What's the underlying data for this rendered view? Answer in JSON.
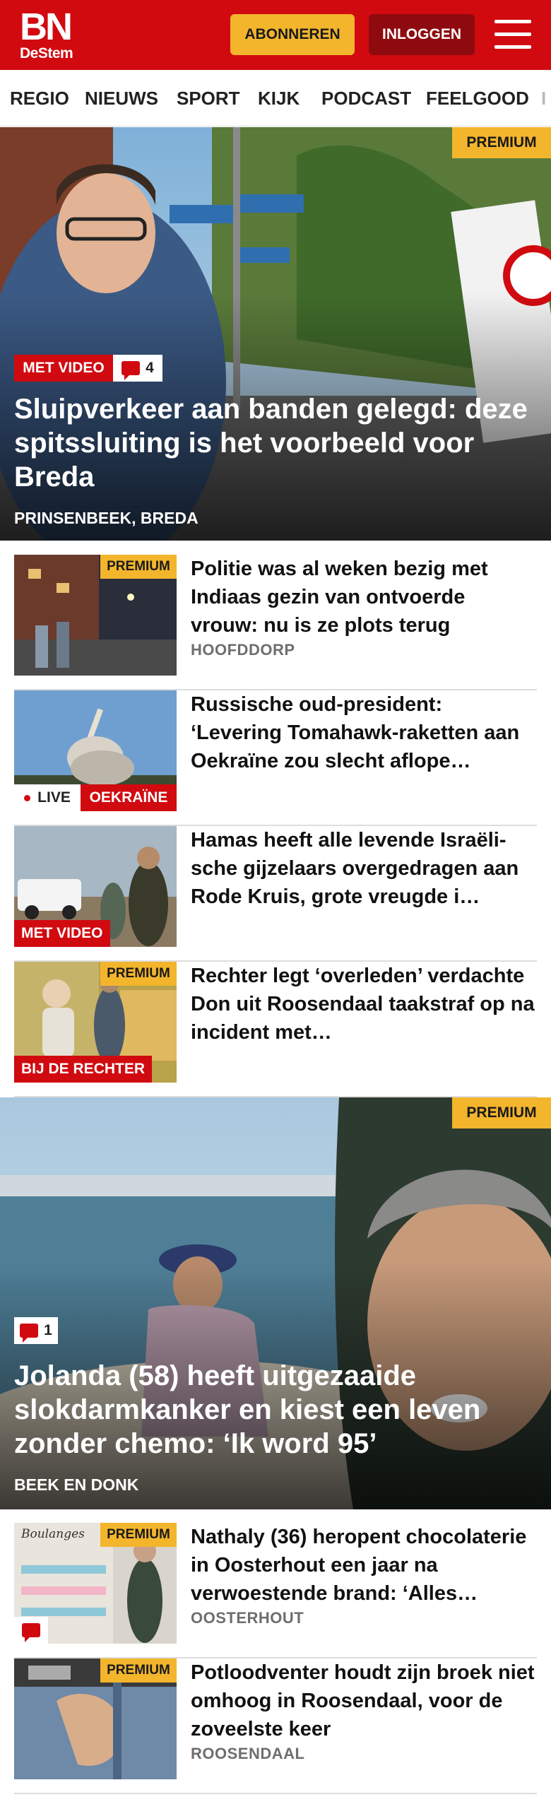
{
  "header": {
    "logo_main": "BN",
    "logo_sub": "DeStem",
    "subscribe_label": "ABONNEREN",
    "login_label": "INLOGGEN",
    "brand_color": "#d10a10",
    "accent_color": "#f3b52c"
  },
  "nav": {
    "items": [
      {
        "label": "REGIO"
      },
      {
        "label": "NIEUWS"
      },
      {
        "label": "SPORT"
      },
      {
        "label": "KIJK"
      },
      {
        "label": "PODCAST"
      },
      {
        "label": "FEELGOOD"
      },
      {
        "label": "I"
      }
    ]
  },
  "hero1": {
    "premium": "PREMIUM",
    "badge": "MET VIDEO",
    "comments": "4",
    "title": "Sluipverkeer aan banden gelegd: deze spitssluiting is het voorbeeld voor Breda",
    "location": "PRINSENBEEK, BREDA"
  },
  "articles": [
    {
      "title": "Politie was al weken bezig met Indiaas gezin van ontvoerde vrouw: nu is ze plots terug",
      "location": "HOOFDDORP",
      "premium": "PREMIUM"
    },
    {
      "title": "Russische oud-president: ‘Levering Tomahawk-raketten aan Oekraïne zou slecht aflope…",
      "live": "LIVE",
      "badge": "OEKRAÏNE"
    },
    {
      "title": "Hamas heeft alle levende Israëli­sche gijzelaars overgedragen aan Rode Kruis, grote vreugde i…",
      "badge": "MET VIDEO"
    },
    {
      "title": "Rechter legt ‘overleden’ verdachte Don uit Roosendaal taakstraf op na incident met…",
      "premium": "PREMIUM",
      "badge": "BIJ DE RECHTER"
    }
  ],
  "hero2": {
    "premium": "PREMIUM",
    "comments": "1",
    "title": "Jolanda (58) heeft uitgezaaide slokdarmkanker en kiest een leven zonder chemo: ‘Ik word 95’",
    "location": "BEEK EN DONK"
  },
  "articles2": [
    {
      "title": "Nathaly (36) heropent chocolate­rie in Oosterhout een jaar na verwoestende brand: ‘Alles…",
      "location": "OOSTERHOUT",
      "premium": "PREMIUM",
      "thumb_sign": "Boulanges"
    },
    {
      "title": "Potloodventer houdt zijn broek niet omhoog in Roosendaal, voor de zoveelste keer",
      "location": "ROOSENDAAL",
      "premium": "PREMIUM"
    }
  ]
}
